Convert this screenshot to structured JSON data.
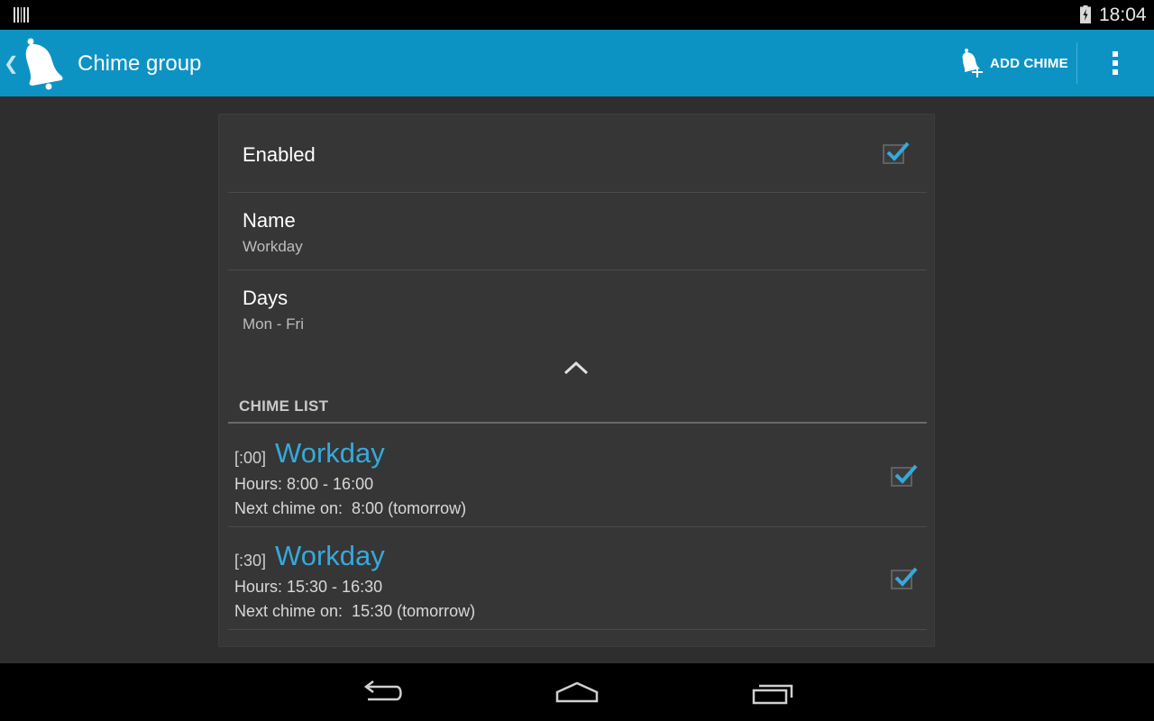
{
  "status_bar": {
    "time": "18:04"
  },
  "action_bar": {
    "title": "Chime group",
    "add_chime_label": "ADD CHIME"
  },
  "preferences": {
    "enabled": {
      "title": "Enabled",
      "checked": true
    },
    "name": {
      "title": "Name",
      "summary": "Workday"
    },
    "days": {
      "title": "Days",
      "summary": "Mon - Fri"
    }
  },
  "chime_list": {
    "header": "CHIME LIST",
    "items": [
      {
        "offset": "[:00]",
        "name": "Workday",
        "hours": "Hours: 8:00 - 16:00",
        "next": "Next chime on:  8:00 (tomorrow)",
        "checked": true
      },
      {
        "offset": "[:30]",
        "name": "Workday",
        "hours": "Hours: 15:30 - 16:30",
        "next": "Next chime on:  15:30 (tomorrow)",
        "checked": true
      }
    ]
  },
  "colors": {
    "action_bar": "#0d93c3",
    "accent": "#36a9db",
    "background": "#2e2e2e",
    "card": "#363636"
  },
  "icons": {
    "app": "bell-icon",
    "add_chime": "bell-plus-icon",
    "overflow": "overflow-menu-icon",
    "nav": [
      "back-icon",
      "home-icon",
      "recents-icon"
    ]
  }
}
